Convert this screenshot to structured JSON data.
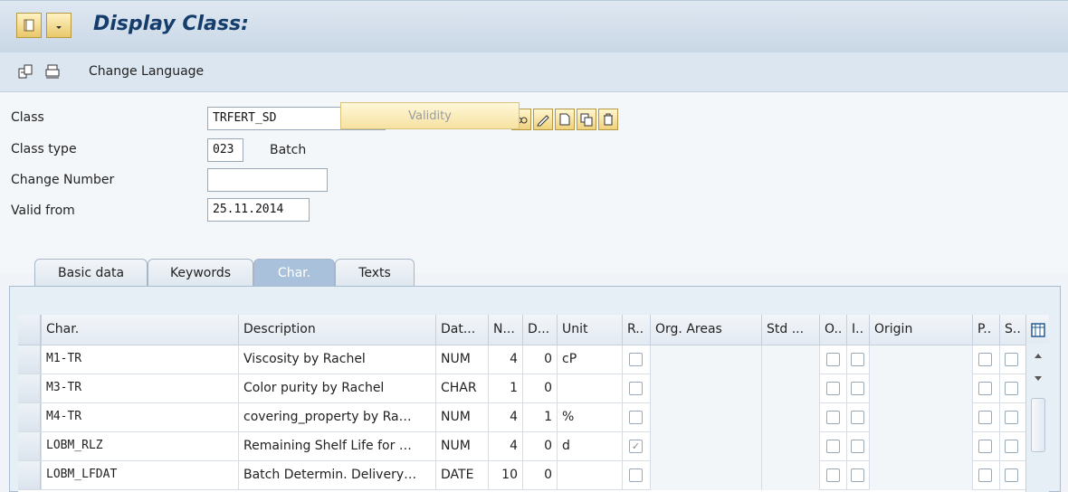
{
  "window": {
    "title": "Display Class:",
    "menu_icon": "menu-icon",
    "menu_dropdown_icon": "dropdown-icon"
  },
  "appbar": {
    "change_language": "Change Language",
    "icons": [
      "characteristic-icon",
      "print-icon"
    ]
  },
  "form": {
    "class_label": "Class",
    "class_value": "TRFERT_SD",
    "class_type_label": "Class type",
    "class_type_value": "023",
    "class_type_text": "Batch",
    "change_number_label": "Change Number",
    "change_number_value": "",
    "valid_from_label": "Valid from",
    "valid_from_value": "25.11.2014",
    "validity_button": "Validity",
    "tools": [
      "display-icon",
      "edit-icon",
      "create-icon",
      "copy-icon",
      "delete-icon"
    ]
  },
  "tabs": [
    {
      "label": "Basic data",
      "active": false
    },
    {
      "label": "Keywords",
      "active": false
    },
    {
      "label": "Char.",
      "active": true
    },
    {
      "label": "Texts",
      "active": false
    }
  ],
  "grid": {
    "columns": [
      "Char.",
      "Description",
      "Dat...",
      "N...",
      "D...",
      "Unit",
      "R..",
      "Org. Areas",
      "Std ...",
      "O..",
      "I..",
      "Origin",
      "P..",
      "S.."
    ],
    "rows": [
      {
        "char": "M1-TR",
        "description": "Viscosity by Rachel",
        "dat": "NUM",
        "n": "4",
        "d": "0",
        "unit": "cP",
        "r": false
      },
      {
        "char": "M3-TR",
        "description": "Color purity by Rachel",
        "dat": "CHAR",
        "n": "1",
        "d": "0",
        "unit": "",
        "r": false
      },
      {
        "char": "M4-TR",
        "description": "covering_property by Ra…",
        "dat": "NUM",
        "n": "4",
        "d": "1",
        "unit": "%",
        "r": false
      },
      {
        "char": "LOBM_RLZ",
        "description": "Remaining Shelf Life for …",
        "dat": "NUM",
        "n": "4",
        "d": "0",
        "unit": "d",
        "r": true
      },
      {
        "char": "LOBM_LFDAT",
        "description": "Batch Determin. Delivery…",
        "dat": "DATE",
        "n": "10",
        "d": "0",
        "unit": "",
        "r": false
      }
    ]
  },
  "colors": {
    "title": "#153d6b",
    "button_yellow": "#f0d27d",
    "active_tab": "#aac1dc"
  }
}
